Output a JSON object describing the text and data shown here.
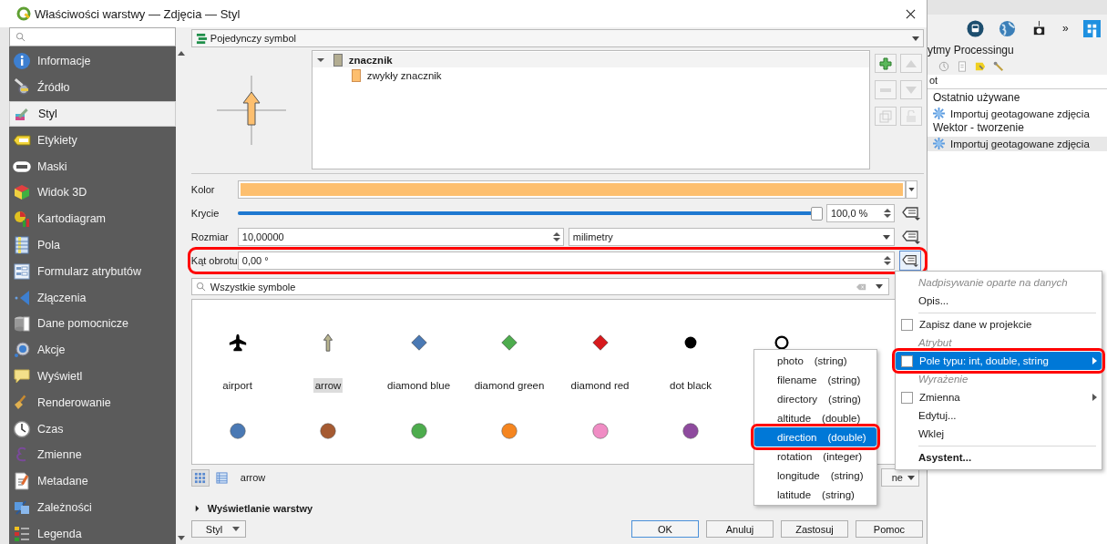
{
  "window": {
    "title": "Właściwości warstwy — Zdjęcia — Styl"
  },
  "sidebar": {
    "items": [
      {
        "label": "Informacje",
        "selected": false
      },
      {
        "label": "Źródło",
        "selected": false
      },
      {
        "label": "Styl",
        "selected": true
      },
      {
        "label": "Etykiety",
        "selected": false
      },
      {
        "label": "Maski",
        "selected": false
      },
      {
        "label": "Widok 3D",
        "selected": false
      },
      {
        "label": "Kartodiagram",
        "selected": false
      },
      {
        "label": "Pola",
        "selected": false
      },
      {
        "label": "Formularz atrybutów",
        "selected": false
      },
      {
        "label": "Złączenia",
        "selected": false
      },
      {
        "label": "Dane pomocnicze",
        "selected": false
      },
      {
        "label": "Akcje",
        "selected": false
      },
      {
        "label": "Wyświetl",
        "selected": false
      },
      {
        "label": "Renderowanie",
        "selected": false
      },
      {
        "label": "Czas",
        "selected": false
      },
      {
        "label": "Zmienne",
        "selected": false
      },
      {
        "label": "Metadane",
        "selected": false
      },
      {
        "label": "Zależności",
        "selected": false
      },
      {
        "label": "Legenda",
        "selected": false
      }
    ]
  },
  "renderer": {
    "value": "Pojedynczy symbol"
  },
  "symbol_tree": {
    "items": [
      {
        "label": "znacznik",
        "expanded": true,
        "children": [
          {
            "label": "zwykły znacznik"
          }
        ]
      }
    ]
  },
  "properties": {
    "color": {
      "label": "Kolor"
    },
    "opacity": {
      "label": "Krycie",
      "level": 1,
      "value": "100,0 %"
    },
    "size": {
      "label": "Rozmiar",
      "value": "10,00000",
      "unit": "milimetry"
    },
    "rotation": {
      "label": "Kąt obrotu",
      "value": "0,00 °",
      "highlighted": true
    }
  },
  "symbol_search": {
    "value": "Wszystkie symbole"
  },
  "symbols": [
    {
      "kind": "airport",
      "name": "airport",
      "color": "#000000",
      "selected": false
    },
    {
      "kind": "arrow",
      "name": "arrow",
      "color": "#b8b48e",
      "selected": true
    },
    {
      "kind": "diamond",
      "name": "diamond blue",
      "color": "#4a79b4",
      "selected": false
    },
    {
      "kind": "diamond",
      "name": "diamond green",
      "color": "#4dac4d",
      "selected": false
    },
    {
      "kind": "diamond",
      "name": "diamond red",
      "color": "#d7191c",
      "selected": false
    },
    {
      "kind": "dot",
      "name": "dot  black",
      "color": "#000000",
      "selected": false
    },
    {
      "kind": "ring",
      "color": "#000000"
    },
    {
      "kind": "circle",
      "color": "#4a79b4"
    },
    {
      "kind": "circle",
      "color": "#a55a31"
    },
    {
      "kind": "circle",
      "color": "#4dac4d"
    },
    {
      "kind": "circle",
      "color": "#f5851f"
    },
    {
      "kind": "circle",
      "color": "#f08cc4"
    },
    {
      "kind": "circle",
      "color": "#8e4a9e"
    }
  ],
  "selected_symbol": "arrow",
  "view_dropdown": "ne",
  "section": {
    "label": "Wyświetlanie warstwy",
    "expanded": false
  },
  "buttons": {
    "style": "Styl",
    "actions": [
      "OK",
      "Anuluj",
      "Zastosuj",
      "Pomoc"
    ]
  },
  "processing_panel": {
    "more": "»",
    "title": "ytmy Processingu",
    "search": "ot",
    "tree": [
      {
        "label": "Ostatnio używane",
        "children": [
          {
            "label": "Importuj geotagowane zdjęcia",
            "selected": false
          }
        ]
      },
      {
        "label": "Wektor - tworzenie",
        "children": [
          {
            "label": "Importuj geotagowane zdjęcia",
            "selected": true
          }
        ]
      }
    ]
  },
  "context_menu": {
    "items": [
      {
        "kind": "header",
        "label": "Nadpisywanie oparte na danych"
      },
      {
        "kind": "action",
        "label": "Opis..."
      },
      {
        "kind": "separator"
      },
      {
        "kind": "check",
        "label": "Zapisz dane w projekcie",
        "checked": false,
        "submenu": false,
        "selected": false
      },
      {
        "kind": "header",
        "label": "Atrybut"
      },
      {
        "kind": "check",
        "label": "Pole typu: int, double, string",
        "checked": false,
        "submenu": true,
        "selected": true,
        "highlighted": true
      },
      {
        "kind": "header",
        "label": "Wyrażenie"
      },
      {
        "kind": "check",
        "label": "Zmienna",
        "checked": false,
        "submenu": true,
        "selected": false
      },
      {
        "kind": "action",
        "label": "Edytuj..."
      },
      {
        "kind": "action",
        "label": "Wklej"
      },
      {
        "kind": "separator"
      },
      {
        "kind": "bold",
        "label": "Asystent..."
      }
    ]
  },
  "field_menu": {
    "items": [
      {
        "name": "photo",
        "type": "(string)",
        "selected": false
      },
      {
        "name": "filename",
        "type": "(string)",
        "selected": false
      },
      {
        "name": "directory",
        "type": "(string)",
        "selected": false
      },
      {
        "name": "altitude",
        "type": "(double)",
        "selected": false
      },
      {
        "name": "direction",
        "type": "(double)",
        "selected": true,
        "highlighted": true
      },
      {
        "name": "rotation",
        "type": "(integer)",
        "selected": false
      },
      {
        "name": "longitude",
        "type": "(string)",
        "selected": false
      },
      {
        "name": "latitude",
        "type": "(string)",
        "selected": false
      }
    ]
  }
}
